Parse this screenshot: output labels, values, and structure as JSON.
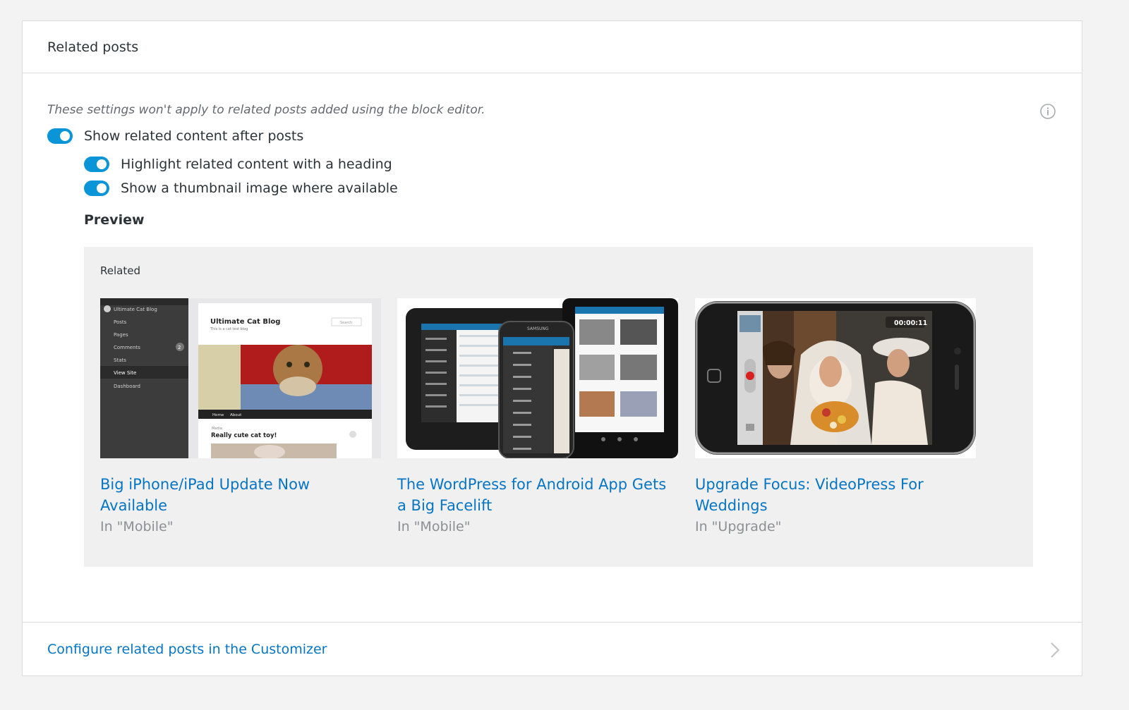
{
  "header": {
    "title": "Related posts"
  },
  "settings": {
    "note": "These settings won't apply to related posts added using the block editor.",
    "toggles": [
      {
        "label": "Show related content after posts",
        "on": true
      },
      {
        "label": "Highlight related content with a heading",
        "on": true
      },
      {
        "label": "Show a thumbnail image where available",
        "on": true
      }
    ]
  },
  "preview": {
    "title": "Preview",
    "heading": "Related",
    "posts": [
      {
        "title": "Big iPhone/iPad Update Now Available",
        "category": "In \"Mobile\""
      },
      {
        "title": "The WordPress for Android App Gets a Big Facelift",
        "category": "In \"Mobile\""
      },
      {
        "title": "Upgrade Focus: VideoPress For Weddings",
        "category": "In \"Upgrade\""
      }
    ]
  },
  "thumb1": {
    "blog_name": "Ultimate Cat Blog",
    "tagline": "This is a cat test blog",
    "search": "Search",
    "nav": [
      "Home",
      "About"
    ],
    "post_meta": "Media",
    "post_title": "Really cute cat toy!",
    "sidebar": [
      "Ultimate Cat Blog",
      "Posts",
      "Pages",
      "Comments",
      "Stats",
      "View Site",
      "Dashboard"
    ],
    "comment_count": "2"
  },
  "thumb2": {
    "brand": "SAMSUNG"
  },
  "thumb3": {
    "timer": "00:00:11"
  },
  "footer": {
    "link": "Configure related posts in the Customizer"
  },
  "colors": {
    "accent": "#0a95d9",
    "link": "#0675c4",
    "muted": "#8c8f94"
  }
}
